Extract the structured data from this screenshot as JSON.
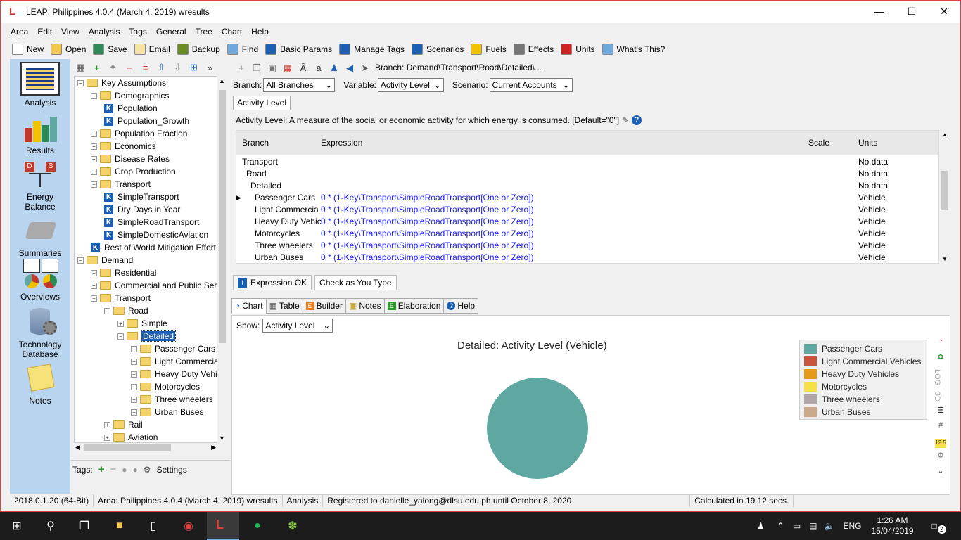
{
  "window": {
    "title": "LEAP: Philippines 4.0.4 (March 4, 2019) wresults"
  },
  "menu": [
    "Area",
    "Edit",
    "View",
    "Analysis",
    "Tags",
    "General",
    "Tree",
    "Chart",
    "Help"
  ],
  "toolbar": [
    {
      "label": "New",
      "icon": "new-icon",
      "color": "#ffffff"
    },
    {
      "label": "Open",
      "icon": "open-icon",
      "color": "#f2c94c"
    },
    {
      "label": "Save",
      "icon": "save-icon",
      "color": "#2e8b57"
    },
    {
      "label": "Email",
      "icon": "email-icon",
      "color": "#f4e3a2"
    },
    {
      "label": "Backup",
      "icon": "backup-icon",
      "color": "#6b8e23"
    },
    {
      "label": "Find",
      "icon": "find-icon",
      "color": "#6fa8dc"
    },
    {
      "label": "Basic Params",
      "icon": "basic-params-icon",
      "color": "#1a5fb4"
    },
    {
      "label": "Manage Tags",
      "icon": "tag-icon",
      "color": "#1a5fb4"
    },
    {
      "label": "Scenarios",
      "icon": "scenarios-icon",
      "color": "#1a5fb4"
    },
    {
      "label": "Fuels",
      "icon": "fuels-icon",
      "color": "#f2c200"
    },
    {
      "label": "Effects",
      "icon": "effects-icon",
      "color": "#777777"
    },
    {
      "label": "Units",
      "icon": "units-icon",
      "color": "#cc2222"
    },
    {
      "label": "What's This?",
      "icon": "help-icon",
      "color": "#6fa8dc"
    }
  ],
  "sidebar": [
    {
      "label": "Analysis"
    },
    {
      "label": "Results"
    },
    {
      "label": "Energy\nBalance"
    },
    {
      "label": "Summaries"
    },
    {
      "label": "Overviews"
    },
    {
      "label": "Technology\nDatabase"
    },
    {
      "label": "Notes"
    }
  ],
  "tree": [
    {
      "label": "Key Assumptions",
      "type": "folder",
      "exp": "−"
    },
    {
      "label": "Demographics",
      "type": "folder",
      "exp": "−"
    },
    {
      "label": "Population",
      "type": "k"
    },
    {
      "label": "Population_Growth",
      "type": "k"
    },
    {
      "label": "Population Fraction",
      "type": "folder",
      "exp": "+"
    },
    {
      "label": "Economics",
      "type": "folder",
      "exp": "+"
    },
    {
      "label": "Disease Rates",
      "type": "folder",
      "exp": "+"
    },
    {
      "label": "Crop Production",
      "type": "folder",
      "exp": "+"
    },
    {
      "label": "Transport",
      "type": "folder",
      "exp": "−"
    },
    {
      "label": "SimpleTransport",
      "type": "k"
    },
    {
      "label": "Dry Days in Year",
      "type": "k"
    },
    {
      "label": "SimpleRoadTransport",
      "type": "k"
    },
    {
      "label": "SimpleDomesticAviation",
      "type": "k"
    },
    {
      "label": "Rest of World Mitigation Effort",
      "type": "k"
    },
    {
      "label": "Demand",
      "type": "folder",
      "exp": "−"
    },
    {
      "label": "Residential",
      "type": "folder",
      "exp": "+"
    },
    {
      "label": "Commercial and Public Services",
      "type": "folder",
      "exp": "+"
    },
    {
      "label": "Transport",
      "type": "folder",
      "exp": "−"
    },
    {
      "label": "Road",
      "type": "folder",
      "exp": "−"
    },
    {
      "label": "Simple",
      "type": "folder",
      "exp": "+"
    },
    {
      "label": "Detailed",
      "type": "folder",
      "exp": "−",
      "selected": true
    },
    {
      "label": "Passenger Cars",
      "type": "folder",
      "exp": "+"
    },
    {
      "label": "Light Commercial Vehicles",
      "type": "folder",
      "exp": "+"
    },
    {
      "label": "Heavy Duty Vehicles",
      "type": "folder",
      "exp": "+"
    },
    {
      "label": "Motorcycles",
      "type": "folder",
      "exp": "+"
    },
    {
      "label": "Three wheelers",
      "type": "folder",
      "exp": "+"
    },
    {
      "label": "Urban Buses",
      "type": "folder",
      "exp": "+"
    },
    {
      "label": "Rail",
      "type": "folder",
      "exp": "+"
    },
    {
      "label": "Aviation",
      "type": "folder",
      "exp": "+"
    }
  ],
  "tags_bar": {
    "label": "Tags:",
    "settings": "Settings"
  },
  "main": {
    "breadcrumb": "Branch: Demand\\Transport\\Road\\Detailed\\...",
    "branch_label": "Branch:",
    "branch_value": "All Branches",
    "variable_label": "Variable:",
    "variable_value": "Activity Level",
    "scenario_label": "Scenario:",
    "scenario_value": "Current Accounts",
    "tab": "Activity Level",
    "description": "Activity Level: A measure of the social or economic activity for which energy is consumed. [Default=\"0\"]",
    "columns": {
      "branch": "Branch",
      "expression": "Expression",
      "scale": "Scale",
      "units": "Units"
    },
    "rows": [
      {
        "branch": "Transport",
        "expr": "",
        "units": "No data"
      },
      {
        "branch": "Road",
        "expr": "",
        "units": "No data"
      },
      {
        "branch": "Detailed",
        "expr": "",
        "units": "No data"
      },
      {
        "branch": "Passenger Cars",
        "expr": "0 * (1-Key\\Transport\\SimpleRoadTransport[One or Zero])",
        "units": "Vehicle"
      },
      {
        "branch": "Light Commercia",
        "expr": "0 * (1-Key\\Transport\\SimpleRoadTransport[One or Zero])",
        "units": "Vehicle"
      },
      {
        "branch": "Heavy Duty Vehic",
        "expr": "0 * (1-Key\\Transport\\SimpleRoadTransport[One or Zero])",
        "units": "Vehicle"
      },
      {
        "branch": "Motorcycles",
        "expr": "0 * (1-Key\\Transport\\SimpleRoadTransport[One or Zero])",
        "units": "Vehicle"
      },
      {
        "branch": "Three wheelers",
        "expr": "0 * (1-Key\\Transport\\SimpleRoadTransport[One or Zero])",
        "units": "Vehicle"
      },
      {
        "branch": "Urban Buses",
        "expr": "0 * (1-Key\\Transport\\SimpleRoadTransport[One or Zero])",
        "units": "Vehicle"
      }
    ],
    "expression_ok": "Expression OK",
    "check_as_you_type": "Check as You Type",
    "chart_tabs": [
      "Chart",
      "Table",
      "Builder",
      "Notes",
      "Elaboration",
      "Help"
    ],
    "show_label": "Show:",
    "show_value": "Activity Level",
    "chart_right_tools": [
      "LOG",
      "3D"
    ]
  },
  "chart_data": {
    "type": "pie",
    "title": "Detailed: Activity Level (Vehicle)",
    "legend_position": "top-right",
    "series": [
      {
        "name": "Passenger Cars",
        "value": 1,
        "color": "#5fa8a2"
      },
      {
        "name": "Light Commercial Vehicles",
        "value": 0,
        "color": "#c8553d"
      },
      {
        "name": "Heavy Duty Vehicles",
        "value": 0,
        "color": "#e69a1a"
      },
      {
        "name": "Motorcycles",
        "value": 0,
        "color": "#f5e04a"
      },
      {
        "name": "Three wheelers",
        "value": 0,
        "color": "#b0a6a8"
      },
      {
        "name": "Urban Buses",
        "value": 0,
        "color": "#caa88a"
      }
    ]
  },
  "statusbar": [
    "2018.0.1.20 (64-Bit)",
    "Area: Philippines 4.0.4 (March 4, 2019) wresults",
    "Analysis",
    "Registered to danielle_yalong@dlsu.edu.ph until October 8, 2020",
    "Calculated in 19.12 secs."
  ],
  "taskbar": {
    "time": "1:26 AM",
    "date": "15/04/2019",
    "lang": "ENG",
    "notif": "2"
  }
}
